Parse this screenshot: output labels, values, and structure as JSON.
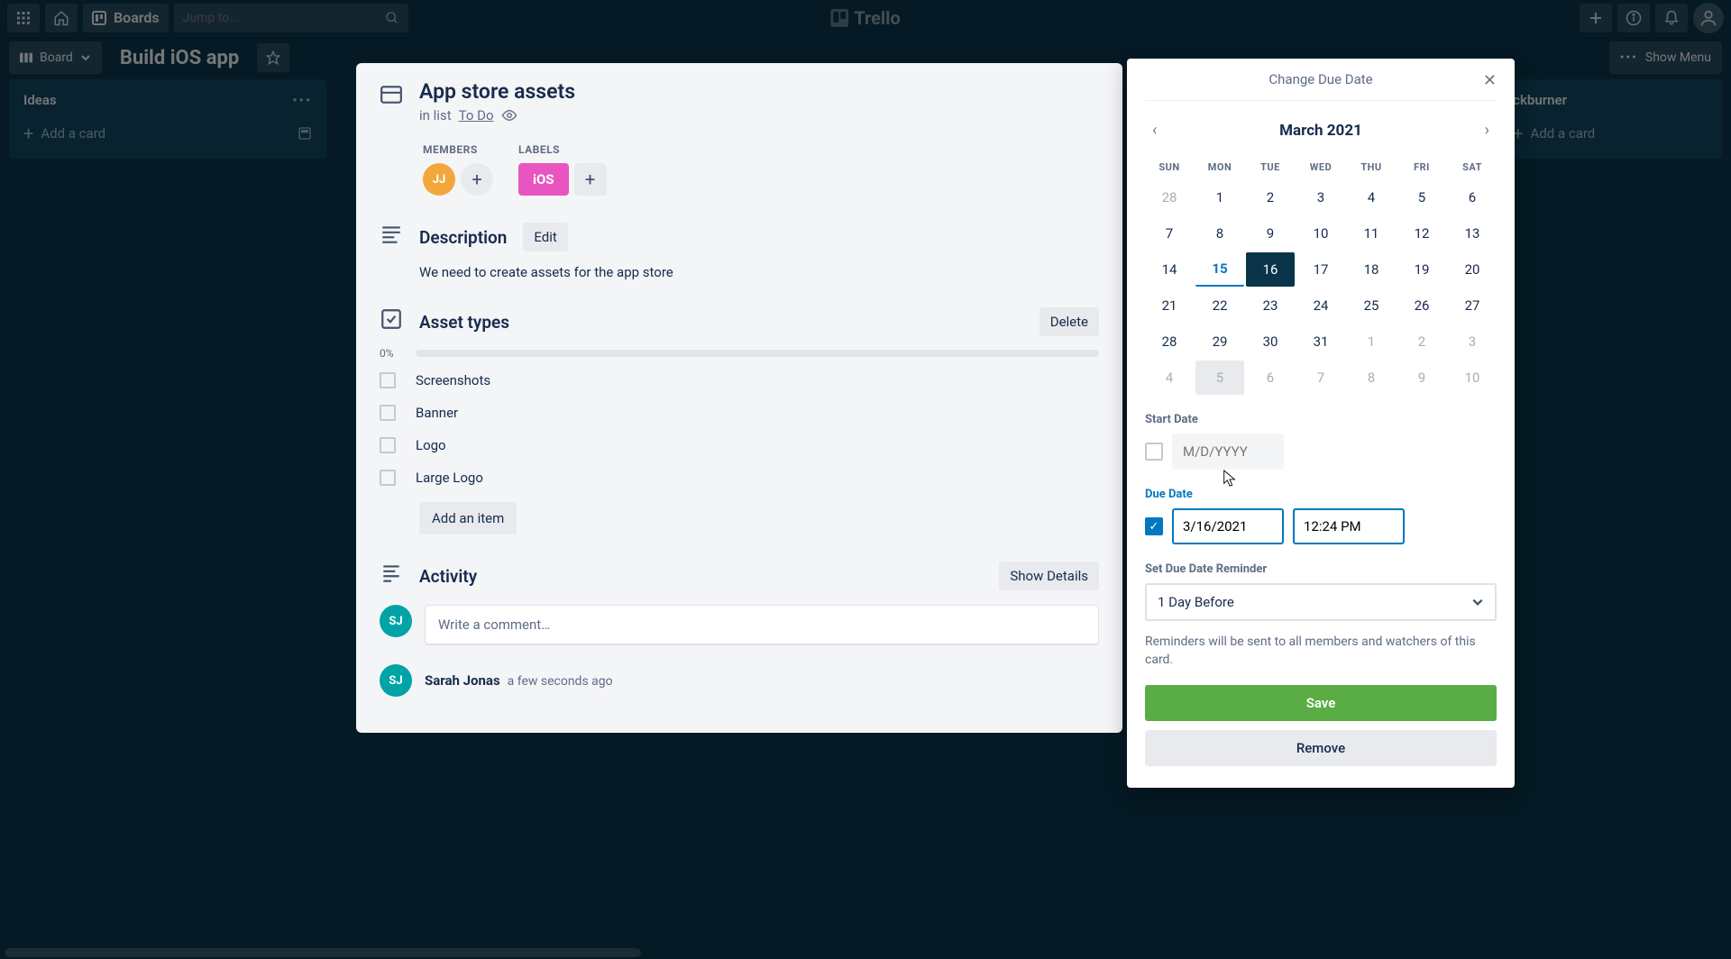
{
  "nav": {
    "boards_label": "Boards",
    "search_placeholder": "Jump to...",
    "logo_text": "Trello"
  },
  "boardbar": {
    "view_label": "Board",
    "board_name": "Build iOS app",
    "show_menu": "Show Menu"
  },
  "columns": {
    "ideas": "Ideas",
    "backburner": "ckburner",
    "add_card": "Add a card"
  },
  "card": {
    "title": "App store assets",
    "in_list_prefix": "in list ",
    "list_name": "To Do",
    "members_label": "MEMBERS",
    "member_initials": "JJ",
    "labels_label": "LABELS",
    "label_text": "iOS",
    "description_heading": "Description",
    "edit_btn": "Edit",
    "description_text": "We need to create assets for the app store",
    "checklist_title": "Asset types",
    "delete_btn": "Delete",
    "progress_pct": "0%",
    "checklist_items": [
      "Screenshots",
      "Banner",
      "Logo",
      "Large Logo"
    ],
    "add_item_btn": "Add an item",
    "activity_heading": "Activity",
    "show_details_btn": "Show Details",
    "comment_placeholder": "Write a comment…",
    "commenter_initials": "SJ",
    "activity_name": "Sarah Jonas",
    "activity_time": "a few seconds ago"
  },
  "datepicker": {
    "title": "Change Due Date",
    "month_label": "March 2021",
    "dow": [
      "SUN",
      "MON",
      "TUE",
      "WED",
      "THU",
      "FRI",
      "SAT"
    ],
    "weeks": [
      [
        {
          "d": 28,
          "outside": true
        },
        {
          "d": 1
        },
        {
          "d": 2
        },
        {
          "d": 3
        },
        {
          "d": 4
        },
        {
          "d": 5
        },
        {
          "d": 6
        }
      ],
      [
        {
          "d": 7
        },
        {
          "d": 8
        },
        {
          "d": 9
        },
        {
          "d": 10
        },
        {
          "d": 11
        },
        {
          "d": 12
        },
        {
          "d": 13
        }
      ],
      [
        {
          "d": 14
        },
        {
          "d": 15,
          "today": true
        },
        {
          "d": 16,
          "selected": true
        },
        {
          "d": 17
        },
        {
          "d": 18
        },
        {
          "d": 19
        },
        {
          "d": 20
        }
      ],
      [
        {
          "d": 21
        },
        {
          "d": 22
        },
        {
          "d": 23
        },
        {
          "d": 24
        },
        {
          "d": 25
        },
        {
          "d": 26
        },
        {
          "d": 27
        }
      ],
      [
        {
          "d": 28
        },
        {
          "d": 29
        },
        {
          "d": 30
        },
        {
          "d": 31
        },
        {
          "d": 1,
          "outside": true
        },
        {
          "d": 2,
          "outside": true
        },
        {
          "d": 3,
          "outside": true
        }
      ],
      [
        {
          "d": 4,
          "outside": true
        },
        {
          "d": 5,
          "outside": true,
          "hover": true
        },
        {
          "d": 6,
          "outside": true
        },
        {
          "d": 7,
          "outside": true
        },
        {
          "d": 8,
          "outside": true
        },
        {
          "d": 9,
          "outside": true
        },
        {
          "d": 10,
          "outside": true
        }
      ]
    ],
    "start_date_label": "Start Date",
    "start_date_placeholder": "M/D/YYYY",
    "due_date_label": "Due Date",
    "due_date_value": "3/16/2021",
    "due_time_value": "12:24 PM",
    "reminder_label": "Set Due Date Reminder",
    "reminder_value": "1 Day Before",
    "helper_text": "Reminders will be sent to all members and watchers of this card.",
    "save_btn": "Save",
    "remove_btn": "Remove"
  }
}
